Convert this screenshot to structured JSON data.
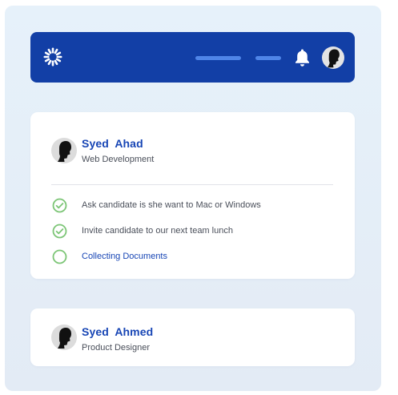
{
  "header": {
    "logo_icon": "sunburst-logo-icon",
    "notification_icon": "bell-icon",
    "avatar_icon": "user-avatar-icon",
    "bar_color": "#123fa6"
  },
  "cards": [
    {
      "name": "Syed  Ahad",
      "role": "Web Development",
      "avatar_icon": "user-avatar-icon",
      "tasks": [
        {
          "label": "Ask candidate is she want to Mac or Windows",
          "done": true
        },
        {
          "label": "Invite candidate to our next team lunch",
          "done": true
        },
        {
          "label": "Collecting Documents",
          "done": false
        }
      ]
    },
    {
      "name": "Syed  Ahmed",
      "role": "Product Designer",
      "avatar_icon": "user-avatar-icon"
    }
  ],
  "colors": {
    "accent": "#1846b5",
    "check": "#7cc576",
    "text": "#4a4f5a"
  }
}
